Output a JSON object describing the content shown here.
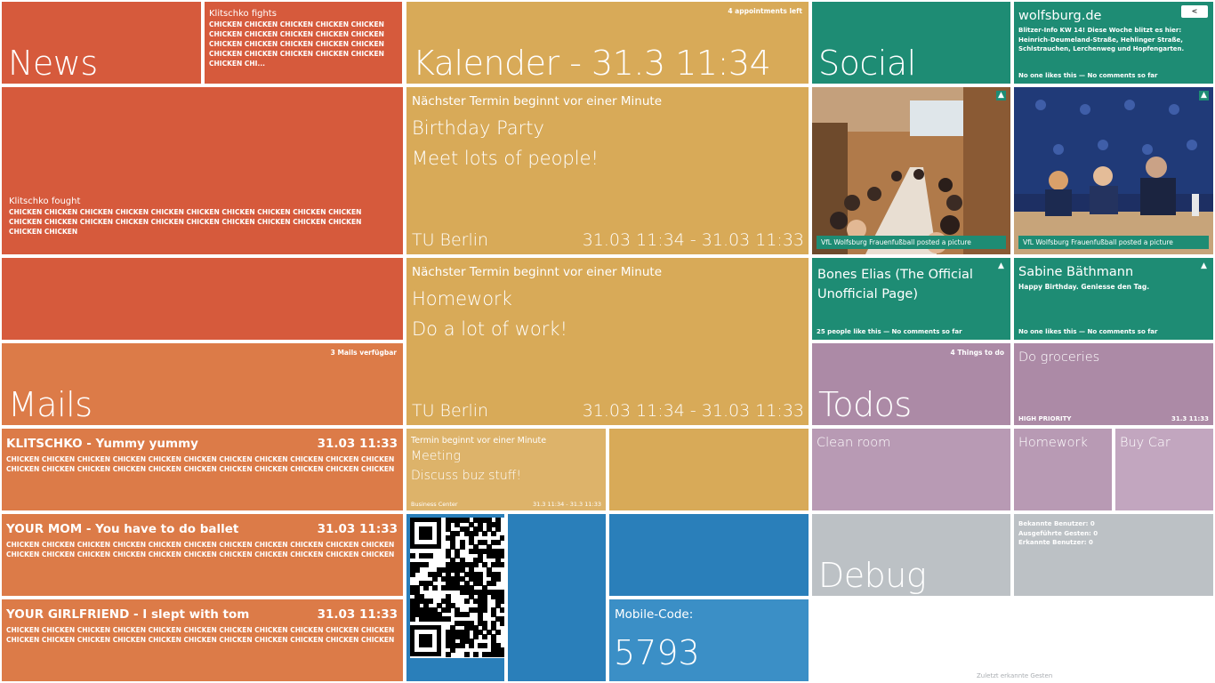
{
  "news": {
    "title": "News",
    "item1": {
      "heading": "Klitschko fights",
      "body": "CHICKEN CHICKEN CHICKEN CHICKEN CHICKEN CHICKEN CHICKEN CHICKEN CHICKEN CHICKEN CHICKEN CHICKEN CHICKEN CHICKEN CHICKEN CHICKEN CHICKEN CHICKEN CHICKEN CHICKEN CHICKEN CHI..."
    },
    "item2": {
      "heading": "Klitschko fought",
      "body": "CHICKEN CHICKEN CHICKEN CHICKEN CHICKEN CHICKEN CHICKEN CHICKEN CHICKEN CHICKEN CHICKEN CHICKEN CHICKEN CHICKEN CHICKEN CHICKEN CHICKEN CHICKEN CHICKEN CHICKEN CHICKEN CHICKEN"
    }
  },
  "mails": {
    "title": "Mails",
    "count": "3 Mails verfügbar",
    "items": [
      {
        "subject": "KLITSCHKO - Yummy yummy",
        "time": "31.03 11:33",
        "body": "CHICKEN CHICKEN CHICKEN CHICKEN CHICKEN CHICKEN CHICKEN CHICKEN CHICKEN CHICKEN CHICKEN CHICKEN CHICKEN CHICKEN CHICKEN CHICKEN CHICKEN CHICKEN CHICKEN CHICKEN CHICKEN CHICKEN"
      },
      {
        "subject": "YOUR MOM - You have to do ballet",
        "time": "31.03 11:33",
        "body": "CHICKEN CHICKEN CHICKEN CHICKEN CHICKEN CHICKEN CHICKEN CHICKEN CHICKEN CHICKEN CHICKEN CHICKEN CHICKEN CHICKEN CHICKEN CHICKEN CHICKEN CHICKEN CHICKEN CHICKEN CHICKEN CHICKEN"
      },
      {
        "subject": "YOUR GIRLFRIEND - I slept with tom",
        "time": "31.03 11:33",
        "body": "CHICKEN CHICKEN CHICKEN CHICKEN CHICKEN CHICKEN CHICKEN CHICKEN CHICKEN CHICKEN CHICKEN CHICKEN CHICKEN CHICKEN CHICKEN CHICKEN CHICKEN CHICKEN CHICKEN CHICKEN CHICKEN CHICKEN"
      }
    ]
  },
  "calendar": {
    "title": "Kalender - 31.3 11:34",
    "count": "4 appointments left",
    "events": [
      {
        "label": "Nächster Termin beginnt vor einer Minute",
        "title": "Birthday Party",
        "desc": "Meet lots of people!",
        "location": "TU Berlin",
        "time": "31.03 11:34 - 31.03 11:33"
      },
      {
        "label": "Nächster Termin beginnt vor einer Minute",
        "title": "Homework",
        "desc": "Do a lot of work!",
        "location": "TU Berlin",
        "time": "31.03 11:34 - 31.03 11:33"
      }
    ],
    "small_event": {
      "label": "Termin beginnt vor einer Minute",
      "title": "Meeting",
      "desc": "Discuss buz stuff!",
      "location": "Business Center",
      "time": "31.3 11:34 - 31.3 11:33"
    }
  },
  "social": {
    "title": "Social",
    "posts": {
      "wolfsburg": {
        "title": "wolfsburg.de",
        "body": "Blitzer-Info KW 14! Diese Woche blitzt es hier: Heinrich-Deumeland-Straße, Hehlinger Straße, Schlstrauchen, Lerchenweg und Hopfengarten.",
        "footer": "No one likes this — No comments so far"
      },
      "photo1": {
        "caption": "VfL Wolfsburg Frauenfußball posted a picture"
      },
      "photo2": {
        "caption": "VfL Wolfsburg Frauenfußball posted a picture"
      },
      "bones": {
        "title": "Bones Elias (The Official Unofficial Page)",
        "footer": "25 people like this — No comments so far"
      },
      "sabine": {
        "title": "Sabine Bäthmann",
        "body": "Happy Birthday. Geniesse den Tag.",
        "footer": "No one likes this — No comments so far"
      }
    },
    "back_label": "<"
  },
  "todos": {
    "title": "Todos",
    "count": "4 Things to do",
    "featured": {
      "title": "Do groceries",
      "priority": "HIGH PRIORITY",
      "date": "31.3 11:33"
    },
    "items": [
      "Clean room",
      "Homework",
      "Buy Car"
    ]
  },
  "debug": {
    "title": "Debug",
    "stats": [
      "Bekannte Benutzer: 0",
      "Ausgeführte Gesten: 0",
      "Erkannte Benutzer: 0"
    ],
    "gestures_label": "Zuletzt erkannte Gesten"
  },
  "mobile": {
    "label": "Mobile-Code:",
    "code": "5793"
  },
  "colors": {
    "news": "#d65a3c",
    "mails": "#dc7b48",
    "calendar": "#d8aa58",
    "calendar_light": "#ddb36a",
    "social": "#1e8c74",
    "todos": "#ac8aa6",
    "todos_light": "#b89ab4",
    "debug": "#bcc1c5",
    "blue": "#2a7fba",
    "blue_light": "#3b8fc6"
  }
}
